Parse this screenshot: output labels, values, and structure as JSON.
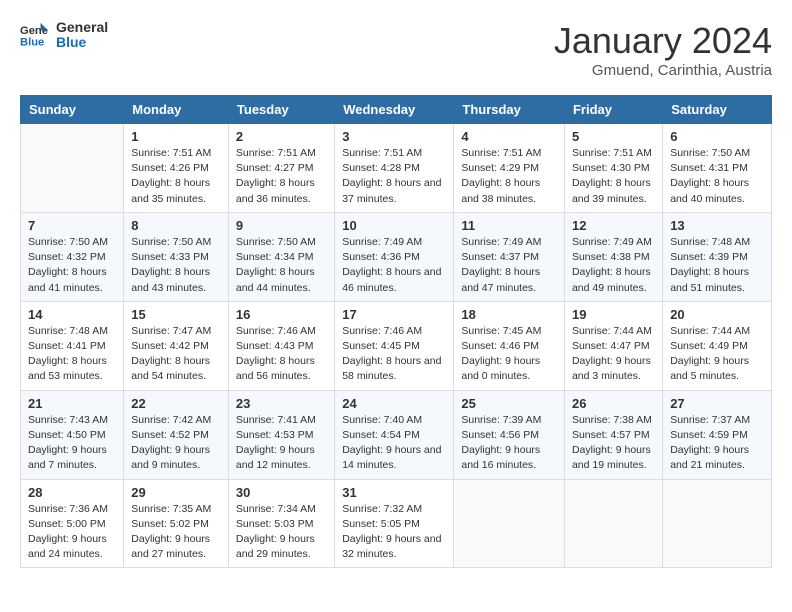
{
  "header": {
    "logo_general": "General",
    "logo_blue": "Blue",
    "month_title": "January 2024",
    "subtitle": "Gmuend, Carinthia, Austria"
  },
  "columns": [
    "Sunday",
    "Monday",
    "Tuesday",
    "Wednesday",
    "Thursday",
    "Friday",
    "Saturday"
  ],
  "weeks": [
    [
      {
        "day": "",
        "sunrise": "",
        "sunset": "",
        "daylight": ""
      },
      {
        "day": "1",
        "sunrise": "Sunrise: 7:51 AM",
        "sunset": "Sunset: 4:26 PM",
        "daylight": "Daylight: 8 hours and 35 minutes."
      },
      {
        "day": "2",
        "sunrise": "Sunrise: 7:51 AM",
        "sunset": "Sunset: 4:27 PM",
        "daylight": "Daylight: 8 hours and 36 minutes."
      },
      {
        "day": "3",
        "sunrise": "Sunrise: 7:51 AM",
        "sunset": "Sunset: 4:28 PM",
        "daylight": "Daylight: 8 hours and 37 minutes."
      },
      {
        "day": "4",
        "sunrise": "Sunrise: 7:51 AM",
        "sunset": "Sunset: 4:29 PM",
        "daylight": "Daylight: 8 hours and 38 minutes."
      },
      {
        "day": "5",
        "sunrise": "Sunrise: 7:51 AM",
        "sunset": "Sunset: 4:30 PM",
        "daylight": "Daylight: 8 hours and 39 minutes."
      },
      {
        "day": "6",
        "sunrise": "Sunrise: 7:50 AM",
        "sunset": "Sunset: 4:31 PM",
        "daylight": "Daylight: 8 hours and 40 minutes."
      }
    ],
    [
      {
        "day": "7",
        "sunrise": "Sunrise: 7:50 AM",
        "sunset": "Sunset: 4:32 PM",
        "daylight": "Daylight: 8 hours and 41 minutes."
      },
      {
        "day": "8",
        "sunrise": "Sunrise: 7:50 AM",
        "sunset": "Sunset: 4:33 PM",
        "daylight": "Daylight: 8 hours and 43 minutes."
      },
      {
        "day": "9",
        "sunrise": "Sunrise: 7:50 AM",
        "sunset": "Sunset: 4:34 PM",
        "daylight": "Daylight: 8 hours and 44 minutes."
      },
      {
        "day": "10",
        "sunrise": "Sunrise: 7:49 AM",
        "sunset": "Sunset: 4:36 PM",
        "daylight": "Daylight: 8 hours and 46 minutes."
      },
      {
        "day": "11",
        "sunrise": "Sunrise: 7:49 AM",
        "sunset": "Sunset: 4:37 PM",
        "daylight": "Daylight: 8 hours and 47 minutes."
      },
      {
        "day": "12",
        "sunrise": "Sunrise: 7:49 AM",
        "sunset": "Sunset: 4:38 PM",
        "daylight": "Daylight: 8 hours and 49 minutes."
      },
      {
        "day": "13",
        "sunrise": "Sunrise: 7:48 AM",
        "sunset": "Sunset: 4:39 PM",
        "daylight": "Daylight: 8 hours and 51 minutes."
      }
    ],
    [
      {
        "day": "14",
        "sunrise": "Sunrise: 7:48 AM",
        "sunset": "Sunset: 4:41 PM",
        "daylight": "Daylight: 8 hours and 53 minutes."
      },
      {
        "day": "15",
        "sunrise": "Sunrise: 7:47 AM",
        "sunset": "Sunset: 4:42 PM",
        "daylight": "Daylight: 8 hours and 54 minutes."
      },
      {
        "day": "16",
        "sunrise": "Sunrise: 7:46 AM",
        "sunset": "Sunset: 4:43 PM",
        "daylight": "Daylight: 8 hours and 56 minutes."
      },
      {
        "day": "17",
        "sunrise": "Sunrise: 7:46 AM",
        "sunset": "Sunset: 4:45 PM",
        "daylight": "Daylight: 8 hours and 58 minutes."
      },
      {
        "day": "18",
        "sunrise": "Sunrise: 7:45 AM",
        "sunset": "Sunset: 4:46 PM",
        "daylight": "Daylight: 9 hours and 0 minutes."
      },
      {
        "day": "19",
        "sunrise": "Sunrise: 7:44 AM",
        "sunset": "Sunset: 4:47 PM",
        "daylight": "Daylight: 9 hours and 3 minutes."
      },
      {
        "day": "20",
        "sunrise": "Sunrise: 7:44 AM",
        "sunset": "Sunset: 4:49 PM",
        "daylight": "Daylight: 9 hours and 5 minutes."
      }
    ],
    [
      {
        "day": "21",
        "sunrise": "Sunrise: 7:43 AM",
        "sunset": "Sunset: 4:50 PM",
        "daylight": "Daylight: 9 hours and 7 minutes."
      },
      {
        "day": "22",
        "sunrise": "Sunrise: 7:42 AM",
        "sunset": "Sunset: 4:52 PM",
        "daylight": "Daylight: 9 hours and 9 minutes."
      },
      {
        "day": "23",
        "sunrise": "Sunrise: 7:41 AM",
        "sunset": "Sunset: 4:53 PM",
        "daylight": "Daylight: 9 hours and 12 minutes."
      },
      {
        "day": "24",
        "sunrise": "Sunrise: 7:40 AM",
        "sunset": "Sunset: 4:54 PM",
        "daylight": "Daylight: 9 hours and 14 minutes."
      },
      {
        "day": "25",
        "sunrise": "Sunrise: 7:39 AM",
        "sunset": "Sunset: 4:56 PM",
        "daylight": "Daylight: 9 hours and 16 minutes."
      },
      {
        "day": "26",
        "sunrise": "Sunrise: 7:38 AM",
        "sunset": "Sunset: 4:57 PM",
        "daylight": "Daylight: 9 hours and 19 minutes."
      },
      {
        "day": "27",
        "sunrise": "Sunrise: 7:37 AM",
        "sunset": "Sunset: 4:59 PM",
        "daylight": "Daylight: 9 hours and 21 minutes."
      }
    ],
    [
      {
        "day": "28",
        "sunrise": "Sunrise: 7:36 AM",
        "sunset": "Sunset: 5:00 PM",
        "daylight": "Daylight: 9 hours and 24 minutes."
      },
      {
        "day": "29",
        "sunrise": "Sunrise: 7:35 AM",
        "sunset": "Sunset: 5:02 PM",
        "daylight": "Daylight: 9 hours and 27 minutes."
      },
      {
        "day": "30",
        "sunrise": "Sunrise: 7:34 AM",
        "sunset": "Sunset: 5:03 PM",
        "daylight": "Daylight: 9 hours and 29 minutes."
      },
      {
        "day": "31",
        "sunrise": "Sunrise: 7:32 AM",
        "sunset": "Sunset: 5:05 PM",
        "daylight": "Daylight: 9 hours and 32 minutes."
      },
      {
        "day": "",
        "sunrise": "",
        "sunset": "",
        "daylight": ""
      },
      {
        "day": "",
        "sunrise": "",
        "sunset": "",
        "daylight": ""
      },
      {
        "day": "",
        "sunrise": "",
        "sunset": "",
        "daylight": ""
      }
    ]
  ]
}
